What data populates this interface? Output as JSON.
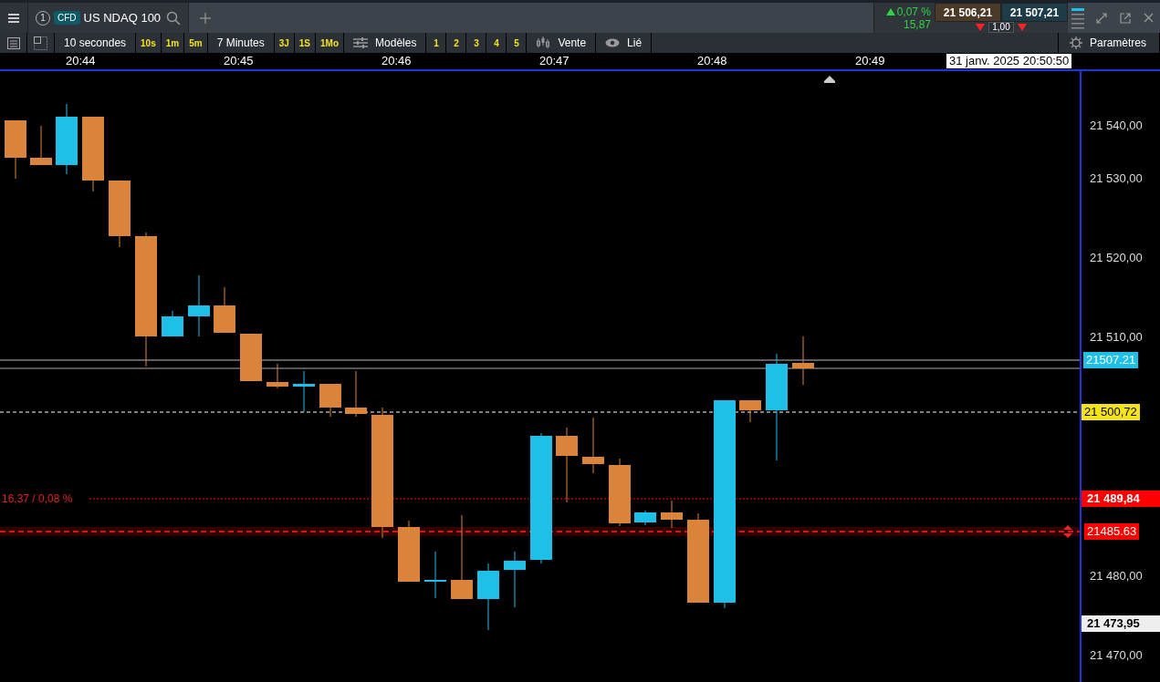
{
  "header": {
    "tab": {
      "number": "1",
      "badge": "CFD",
      "symbol": "US NDAQ 100"
    },
    "change": {
      "percent": "0,07 %",
      "points": "15,87",
      "rising": true
    },
    "bid": {
      "price": "21 506,21",
      "rising": false
    },
    "ask": {
      "price": "21 507,21",
      "rising": false
    },
    "spread": "1,00"
  },
  "toolbar": {
    "timeframe": "10 secondes",
    "quick_intervals": [
      "10s",
      "1m",
      "5m"
    ],
    "range": "7 Minutes",
    "quick_ranges": [
      "3J",
      "1S",
      "1Mo"
    ],
    "templates": "Modèles",
    "presets": [
      "1",
      "2",
      "3",
      "4",
      "5"
    ],
    "sell": "Vente",
    "linked": "Lié",
    "settings": "Paramètres"
  },
  "time_axis": {
    "labels": [
      "20:44",
      "20:45",
      "20:46",
      "20:47",
      "20:48",
      "20:49"
    ],
    "cursor_time": "31 janv. 2025 20:50:50"
  },
  "price_axis": {
    "labels": [
      {
        "text": "21 540,00",
        "kind": "tick"
      },
      {
        "text": "21 530,00",
        "kind": "tick"
      },
      {
        "text": "21 520,00",
        "kind": "tick"
      },
      {
        "text": "21 510,00",
        "kind": "tick"
      },
      {
        "text": "21507.21",
        "kind": "ask"
      },
      {
        "text": "21 500,72",
        "kind": "cursor"
      },
      {
        "text": "21 489,84",
        "kind": "alert"
      },
      {
        "text": "21485.63",
        "kind": "order"
      },
      {
        "text": "21 480,00",
        "kind": "tick"
      },
      {
        "text": "21 473,95",
        "kind": "low"
      },
      {
        "text": "21 470,00",
        "kind": "tick"
      }
    ]
  },
  "chart": {
    "distance_label": "16,37 / 0,08 %"
  }
}
